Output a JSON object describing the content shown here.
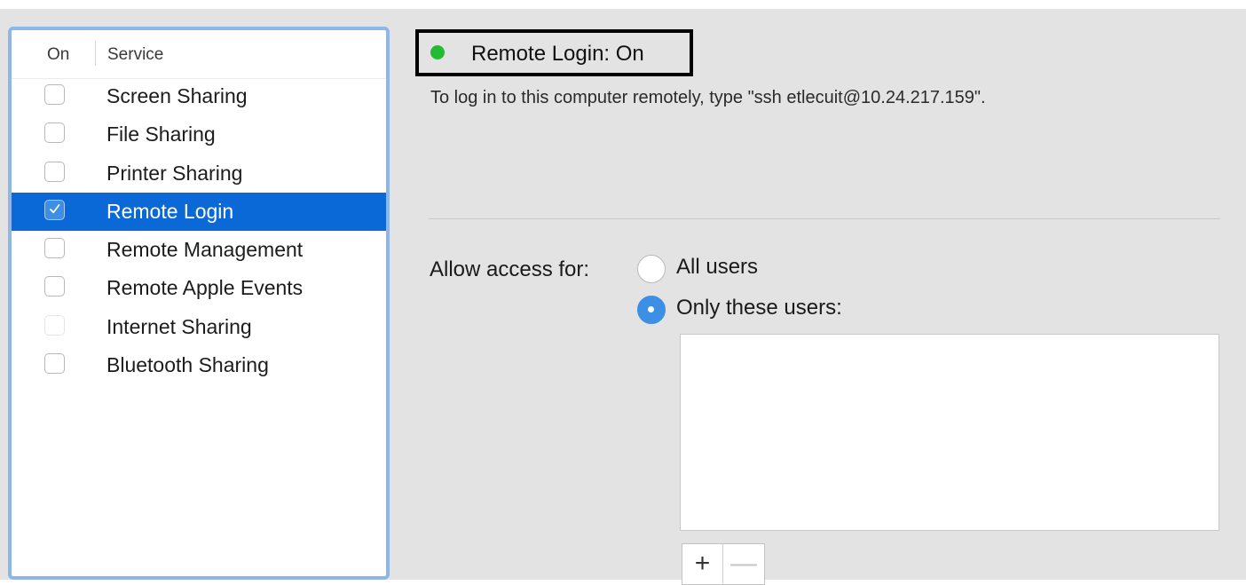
{
  "service_list": {
    "header_on": "On",
    "header_service": "Service",
    "items": [
      {
        "label": "Screen Sharing",
        "checked": false,
        "selected": false,
        "enabled": true
      },
      {
        "label": "File Sharing",
        "checked": false,
        "selected": false,
        "enabled": true
      },
      {
        "label": "Printer Sharing",
        "checked": false,
        "selected": false,
        "enabled": true
      },
      {
        "label": "Remote Login",
        "checked": true,
        "selected": true,
        "enabled": true
      },
      {
        "label": "Remote Management",
        "checked": false,
        "selected": false,
        "enabled": true
      },
      {
        "label": "Remote Apple Events",
        "checked": false,
        "selected": false,
        "enabled": true
      },
      {
        "label": "Internet Sharing",
        "checked": false,
        "selected": false,
        "enabled": false
      },
      {
        "label": "Bluetooth Sharing",
        "checked": false,
        "selected": false,
        "enabled": true
      }
    ]
  },
  "status": {
    "text": "Remote Login: On",
    "indicator_color": "#22bb33"
  },
  "instructions": "To log in to this computer remotely, type \"ssh etlecuit@10.24.217.159\".",
  "access": {
    "label": "Allow access for:",
    "options": [
      {
        "label": "All users",
        "selected": false
      },
      {
        "label": "Only these users:",
        "selected": true
      }
    ],
    "users": []
  },
  "buttons": {
    "add": "+",
    "remove": "—"
  },
  "colors": {
    "selection": "#0b69d7",
    "accent": "#3d8fe6",
    "list_focus_ring": "#8fb6ea"
  }
}
